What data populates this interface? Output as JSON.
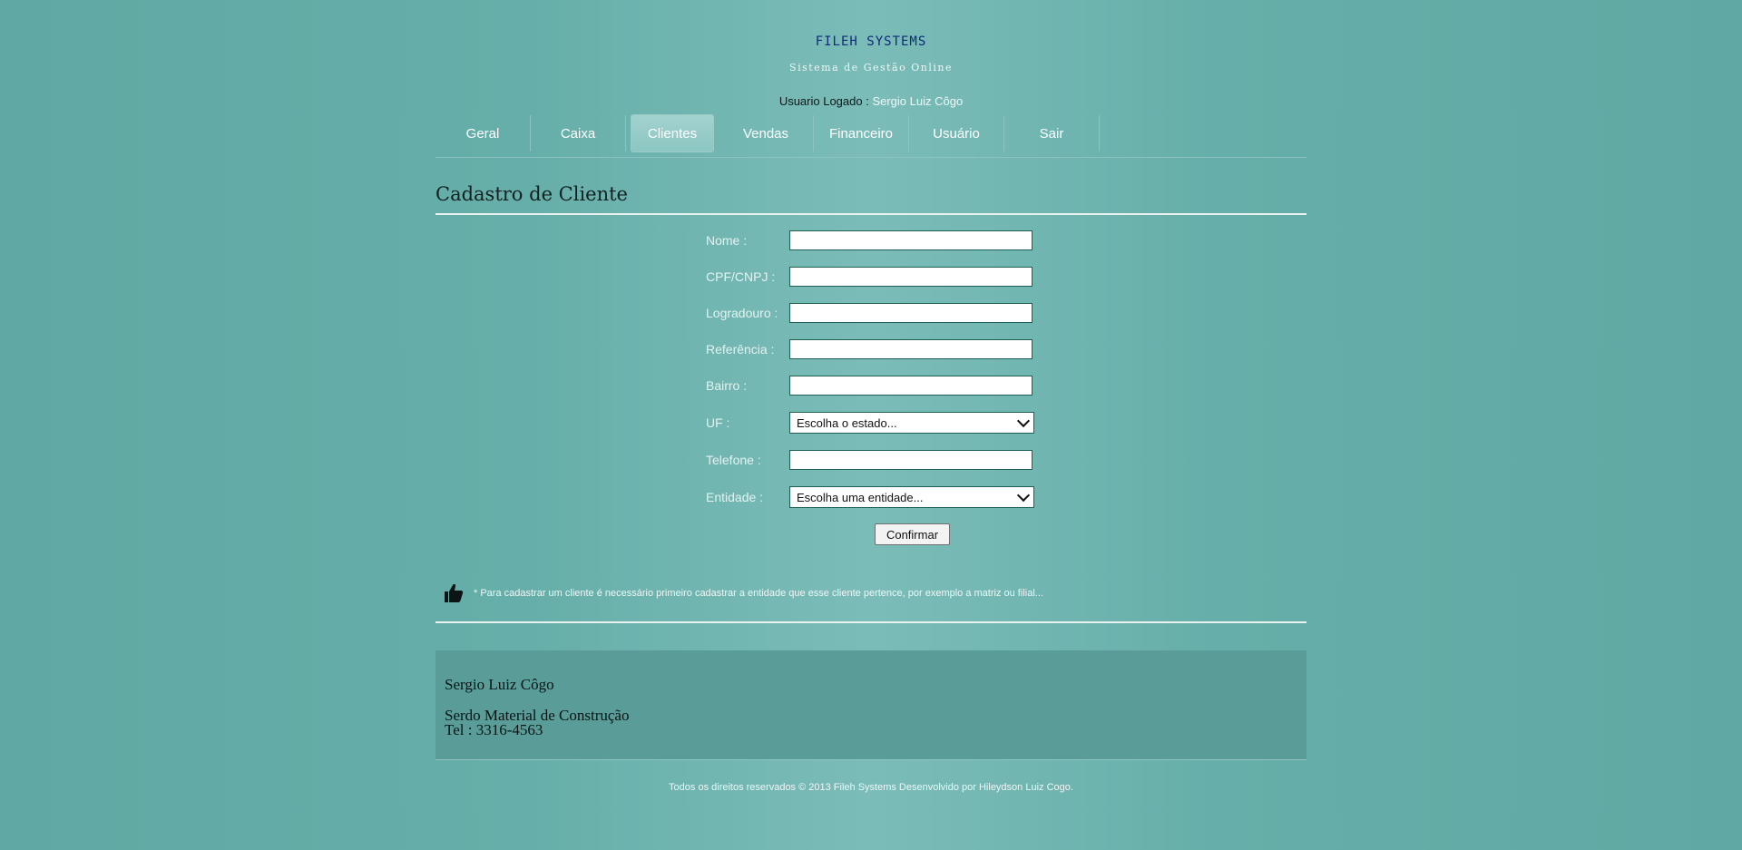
{
  "header": {
    "brand": "FILEH SYSTEMS",
    "subtitle": "Sistema de Gestão Online",
    "user_label": "Usuario Logado :",
    "user_name": "Sergio Luiz Côgo"
  },
  "nav": {
    "items": [
      {
        "label": "Geral"
      },
      {
        "label": "Caixa"
      },
      {
        "label": "Clientes",
        "active": true
      },
      {
        "label": "Vendas"
      },
      {
        "label": "Financeiro"
      },
      {
        "label": "Usuário"
      },
      {
        "label": "Sair"
      }
    ]
  },
  "page": {
    "title": "Cadastro de Cliente"
  },
  "form": {
    "fields": [
      {
        "label": "Nome :",
        "value": ""
      },
      {
        "label": "CPF/CNPJ :",
        "value": ""
      },
      {
        "label": "Logradouro :",
        "value": ""
      },
      {
        "label": "Referência :",
        "value": ""
      },
      {
        "label": "Bairro :",
        "value": ""
      },
      {
        "label": "UF :",
        "selected": "Escolha o estado..."
      },
      {
        "label": "Telefone :",
        "value": ""
      },
      {
        "label": "Entidade :",
        "selected": "Escolha uma entidade..."
      }
    ],
    "confirm_label": "Confirmar"
  },
  "tip": {
    "icon": "thumbs-up-icon",
    "text": "* Para cadastrar um cliente é necessário primeiro cadastrar a entidade que esse cliente pertence, por exemplo a matriz ou filial..."
  },
  "footer_box": {
    "name": "Sergio Luiz Côgo",
    "company": "Serdo Material de Construção",
    "phone": "Tel : 3316-4563"
  },
  "copyright": "Todos os direitos reservados © 2013 Fileh Systems Desenvolvido por Hileydson Luiz Cogo.",
  "colors": {
    "background": "#66aea9",
    "brand": "#102a7a",
    "footer_box": "#5a9c98",
    "active_tab": "#9ccfcc"
  }
}
